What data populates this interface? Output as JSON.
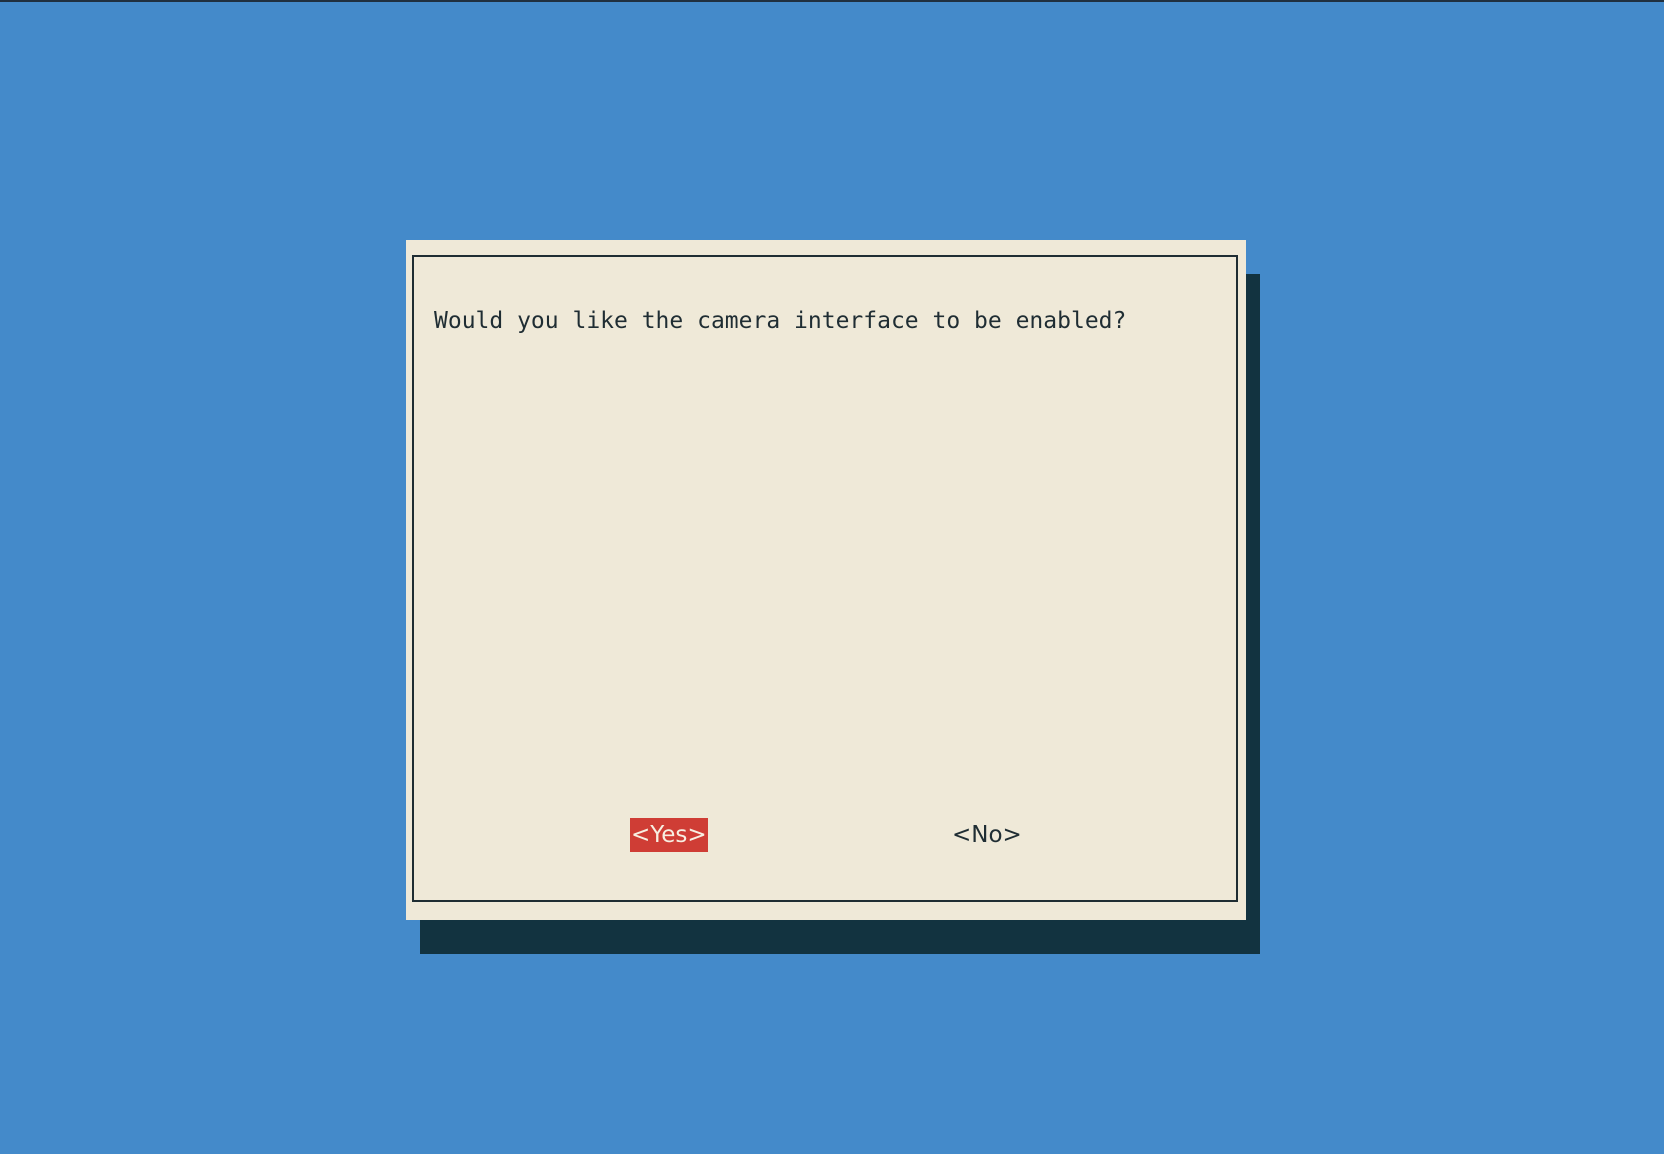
{
  "dialog": {
    "prompt": "Would you like the camera interface to be enabled?",
    "yes_label": "<Yes>",
    "no_label": "<No>"
  },
  "colors": {
    "background": "#448aca",
    "dialog_bg": "#efe9d8",
    "shadow": "#123340",
    "selected_button_bg": "#cf3d35",
    "text": "#1f2d33"
  }
}
